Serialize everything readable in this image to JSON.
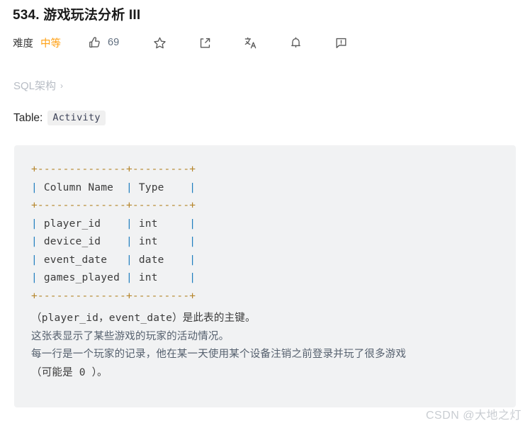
{
  "page": {
    "title": "534. 游戏玩法分析 III"
  },
  "meta": {
    "difficulty_label": "难度",
    "difficulty_value": "中等",
    "difficulty_color": "#ffa116",
    "like_count": "69",
    "icons": [
      {
        "name": "thumbs-up-icon",
        "label": "点赞"
      },
      {
        "name": "star-icon",
        "label": "收藏"
      },
      {
        "name": "share-icon",
        "label": "分享"
      },
      {
        "name": "translate-icon",
        "label": "切换语言"
      },
      {
        "name": "bell-icon",
        "label": "订阅提醒"
      },
      {
        "name": "comment-icon",
        "label": "反馈"
      }
    ]
  },
  "breadcrumb": {
    "label": "SQL架构",
    "chevron": "›"
  },
  "table_intro": {
    "prefix": "Table:",
    "table_name": "Activity"
  },
  "schema": {
    "columns": [
      "Column Name",
      "Type"
    ],
    "rows": [
      {
        "column_name": "player_id",
        "type": "int"
      },
      {
        "column_name": "device_id",
        "type": "int"
      },
      {
        "column_name": "event_date",
        "type": "date"
      },
      {
        "column_name": "games_played",
        "type": "int"
      }
    ],
    "ascii": "+--------------+---------+\n| Column Name  | Type    |\n+--------------+---------+\n| player_id    | int     |\n| device_id    | int     |\n| event_date   | date    |\n| games_played | int     |\n+--------------+---------+",
    "border_color": "#b5852a",
    "pipe_color": "#1f7fbf"
  },
  "description": {
    "line1": "（player_id，event_date）是此表的主键。",
    "line2": "这张表显示了某些游戏的玩家的活动情况。",
    "line3": "每一行是一个玩家的记录，他在某一天使用某个设备注销之前登录并玩了很多游戏",
    "line4": "（可能是 0 ）。"
  },
  "watermark": {
    "text": "CSDN @大地之灯"
  }
}
